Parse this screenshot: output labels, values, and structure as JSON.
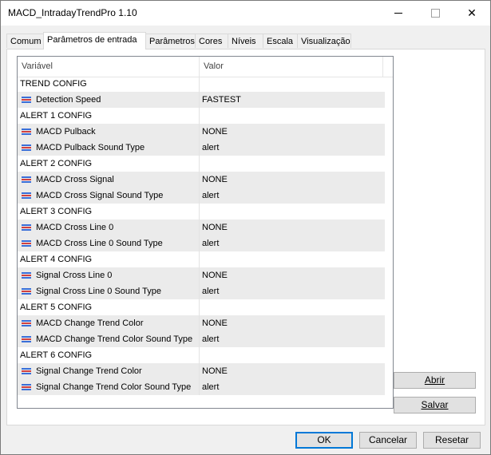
{
  "window": {
    "title": "MACD_IntradayTrendPro 1.10"
  },
  "titlebar": {
    "close_glyph": "✕"
  },
  "tabs": [
    {
      "label": "Comum"
    },
    {
      "label": "Parâmetros de entrada"
    },
    {
      "label": "Parâmetros"
    },
    {
      "label": "Cores"
    },
    {
      "label": "Níveis"
    },
    {
      "label": "Escala"
    },
    {
      "label": "Visualização"
    }
  ],
  "grid": {
    "col_variable": "Variável",
    "col_value": "Valor",
    "rows": [
      {
        "variable": "TREND CONFIG",
        "value": "",
        "group": true
      },
      {
        "variable": "Detection Speed",
        "value": "FASTEST",
        "group": false
      },
      {
        "variable": "ALERT 1 CONFIG",
        "value": "",
        "group": true
      },
      {
        "variable": "MACD Pulback",
        "value": "NONE",
        "group": false
      },
      {
        "variable": "MACD Pulback Sound Type",
        "value": "alert",
        "group": false
      },
      {
        "variable": "ALERT 2 CONFIG",
        "value": "",
        "group": true
      },
      {
        "variable": "MACD Cross Signal",
        "value": "NONE",
        "group": false
      },
      {
        "variable": "MACD Cross Signal Sound Type",
        "value": "alert",
        "group": false
      },
      {
        "variable": "ALERT 3 CONFIG",
        "value": "",
        "group": true
      },
      {
        "variable": "MACD Cross Line 0",
        "value": "NONE",
        "group": false
      },
      {
        "variable": "MACD Cross Line 0 Sound Type",
        "value": "alert",
        "group": false
      },
      {
        "variable": "ALERT 4 CONFIG",
        "value": "",
        "group": true
      },
      {
        "variable": "Signal Cross Line 0",
        "value": "NONE",
        "group": false
      },
      {
        "variable": "Signal Cross Line 0 Sound Type",
        "value": "alert",
        "group": false
      },
      {
        "variable": "ALERT 5 CONFIG",
        "value": "",
        "group": true
      },
      {
        "variable": "MACD Change Trend Color",
        "value": "NONE",
        "group": false
      },
      {
        "variable": "MACD Change Trend Color Sound Type",
        "value": "alert",
        "group": false
      },
      {
        "variable": "ALERT 6 CONFIG",
        "value": "",
        "group": true
      },
      {
        "variable": "Signal Change Trend Color",
        "value": "NONE",
        "group": false
      },
      {
        "variable": "Signal Change Trend Color Sound Type",
        "value": "alert",
        "group": false
      }
    ]
  },
  "side_buttons": {
    "open_label": "Abrir",
    "save_label": "Salvar"
  },
  "footer": {
    "ok_label": "OK",
    "cancel_label": "Cancelar",
    "reset_label": "Resetar"
  }
}
